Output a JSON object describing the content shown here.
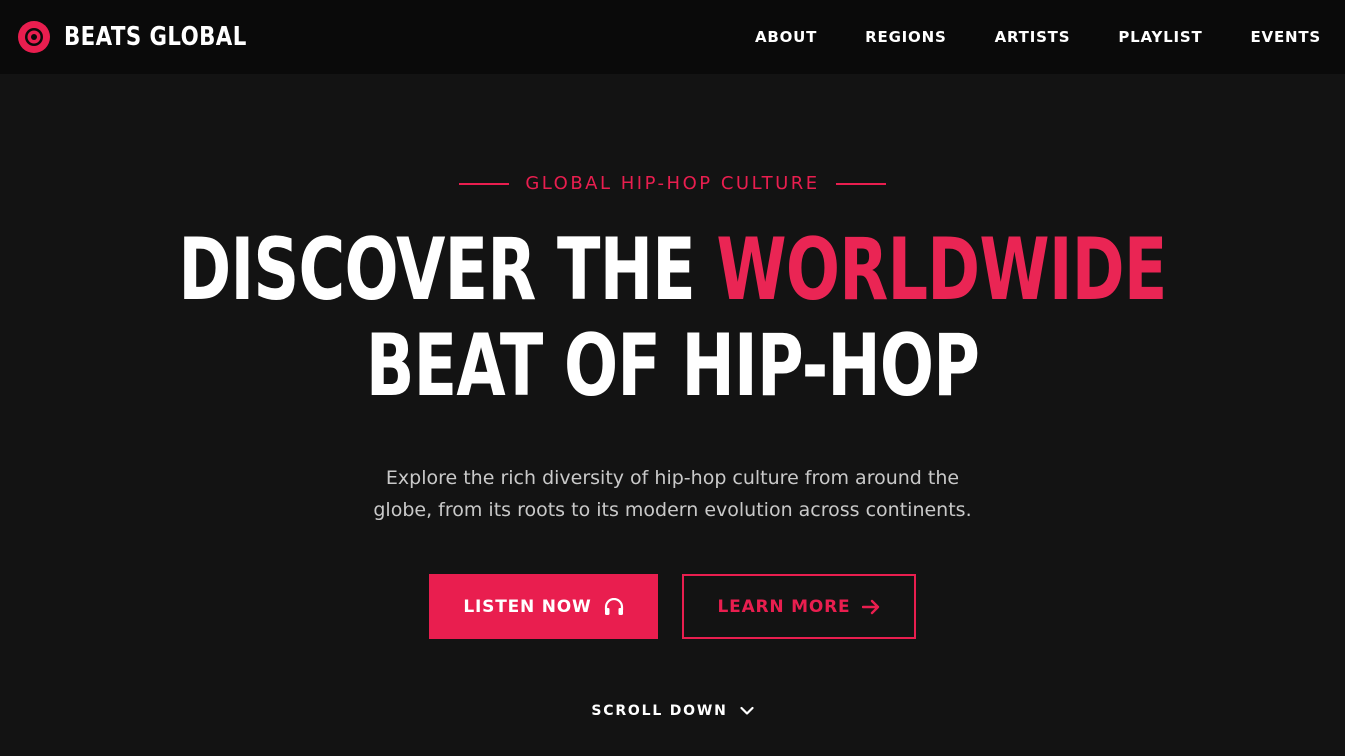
{
  "brand": {
    "name": "BEATS GLOBAL",
    "logo_icon": "record-target-icon",
    "accent_color": "#e91e4f"
  },
  "nav": {
    "items": [
      {
        "label": "ABOUT"
      },
      {
        "label": "REGIONS"
      },
      {
        "label": "ARTISTS"
      },
      {
        "label": "PLAYLIST"
      },
      {
        "label": "EVENTS"
      }
    ]
  },
  "hero": {
    "eyebrow": "GLOBAL HIP-HOP CULTURE",
    "headline_part1": "DISCOVER THE ",
    "headline_accent": "WORLDWIDE",
    "headline_line2": "BEAT OF HIP-HOP",
    "description": "Explore the rich diversity of hip-hop culture from around the globe, from its roots to its modern evolution across continents.",
    "primary_button": {
      "label": "LISTEN NOW",
      "icon": "headphones-icon"
    },
    "secondary_button": {
      "label": "LEARN MORE",
      "icon": "arrow-right-icon"
    },
    "scroll_label": "SCROLL DOWN",
    "scroll_icon": "chevron-down-icon"
  },
  "colors": {
    "background": "#131313",
    "header": "#0a0a0a",
    "accent": "#e91e4f",
    "text": "#ffffff",
    "muted_text": "#c9c9c9"
  }
}
